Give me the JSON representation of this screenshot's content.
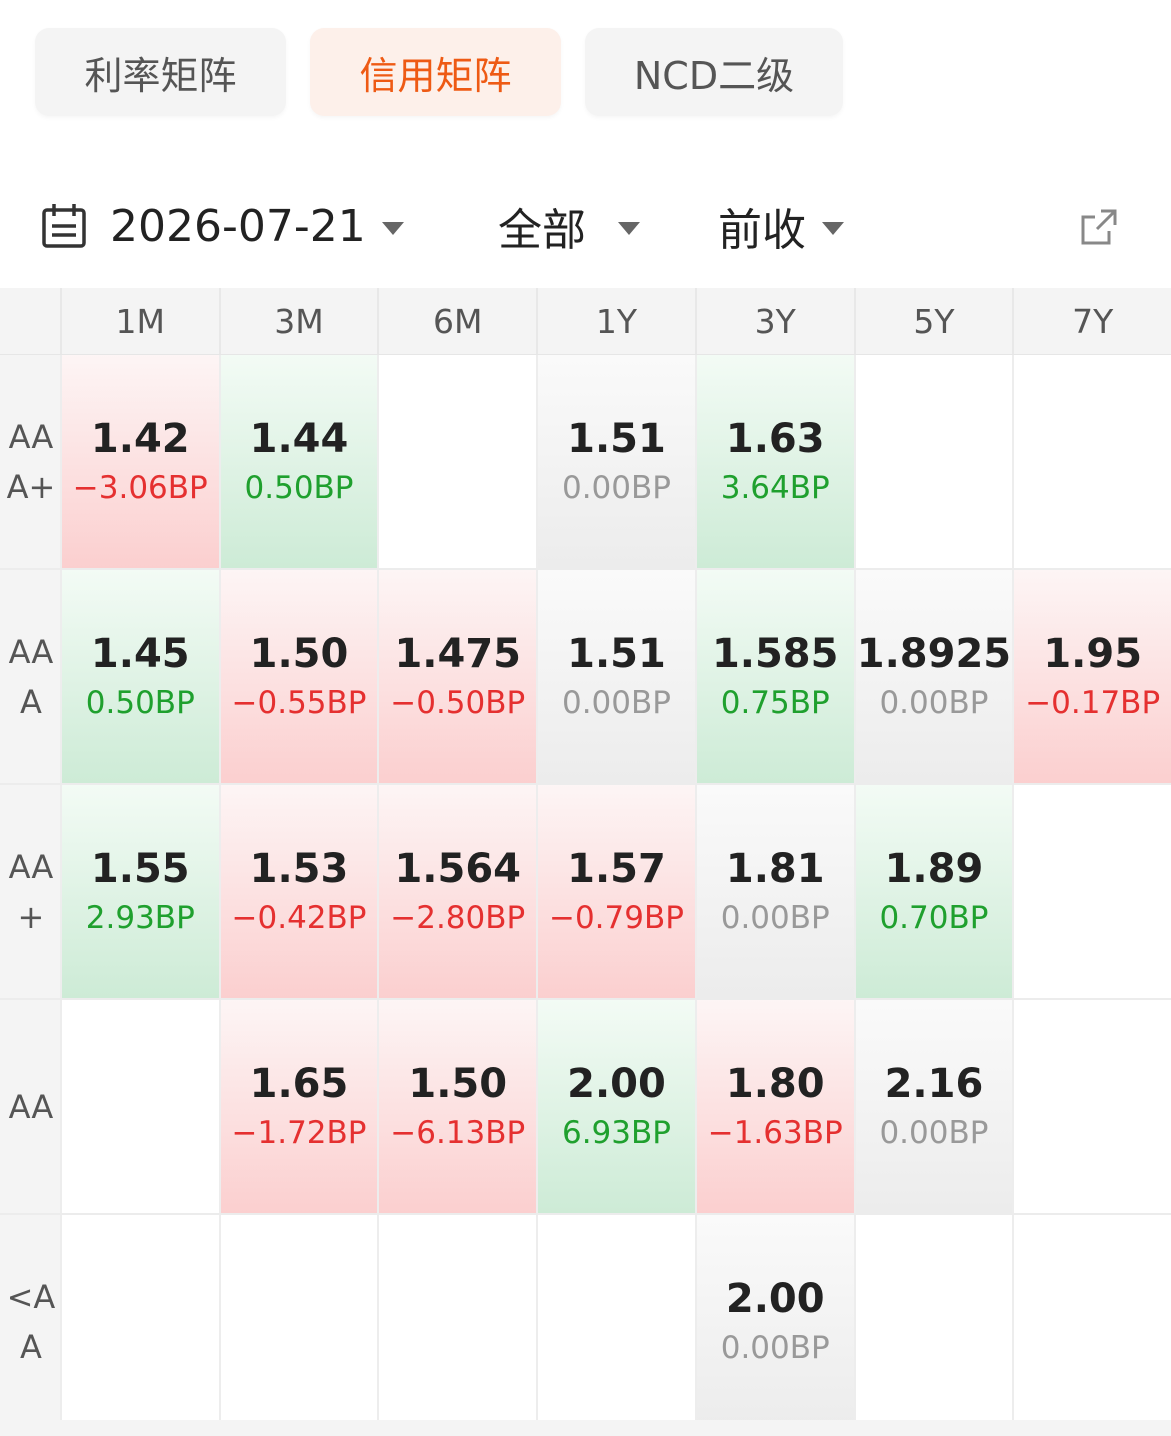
{
  "tabs": [
    {
      "label": "利率矩阵",
      "active": false
    },
    {
      "label": "信用矩阵",
      "active": true
    },
    {
      "label": "NCD二级",
      "active": false
    }
  ],
  "filters": {
    "date": "2026-07-21",
    "scope": "全部",
    "basis": "前收"
  },
  "icons": {
    "calendar": "calendar-icon",
    "export": "external-link-icon",
    "dropdown": "caret-down-icon"
  },
  "colors": {
    "accent": "#ee5a14",
    "up": "#e53030",
    "down": "#1fa02e",
    "flat": "#999999"
  },
  "matrix": {
    "columns": [
      "1M",
      "3M",
      "6M",
      "1Y",
      "3Y",
      "5Y",
      "7Y"
    ],
    "rows": [
      {
        "label": "AAA+",
        "cells": [
          {
            "value": "1.42",
            "change": "−3.06BP",
            "trend": "up"
          },
          {
            "value": "1.44",
            "change": "0.50BP",
            "trend": "down"
          },
          null,
          {
            "value": "1.51",
            "change": "0.00BP",
            "trend": "flat"
          },
          {
            "value": "1.63",
            "change": "3.64BP",
            "trend": "down"
          },
          null,
          null
        ]
      },
      {
        "label": "AAA",
        "cells": [
          {
            "value": "1.45",
            "change": "0.50BP",
            "trend": "down"
          },
          {
            "value": "1.50",
            "change": "−0.55BP",
            "trend": "up"
          },
          {
            "value": "1.475",
            "change": "−0.50BP",
            "trend": "up"
          },
          {
            "value": "1.51",
            "change": "0.00BP",
            "trend": "flat"
          },
          {
            "value": "1.585",
            "change": "0.75BP",
            "trend": "down"
          },
          {
            "value": "1.8925",
            "change": "0.00BP",
            "trend": "flat"
          },
          {
            "value": "1.95",
            "change": "−0.17BP",
            "trend": "up"
          }
        ]
      },
      {
        "label": "AA+",
        "cells": [
          {
            "value": "1.55",
            "change": "2.93BP",
            "trend": "down"
          },
          {
            "value": "1.53",
            "change": "−0.42BP",
            "trend": "up"
          },
          {
            "value": "1.564",
            "change": "−2.80BP",
            "trend": "up"
          },
          {
            "value": "1.57",
            "change": "−0.79BP",
            "trend": "up"
          },
          {
            "value": "1.81",
            "change": "0.00BP",
            "trend": "flat"
          },
          {
            "value": "1.89",
            "change": "0.70BP",
            "trend": "down"
          },
          null
        ]
      },
      {
        "label": "AA",
        "cells": [
          null,
          {
            "value": "1.65",
            "change": "−1.72BP",
            "trend": "up"
          },
          {
            "value": "1.50",
            "change": "−6.13BP",
            "trend": "up"
          },
          {
            "value": "2.00",
            "change": "6.93BP",
            "trend": "down"
          },
          {
            "value": "1.80",
            "change": "−1.63BP",
            "trend": "up"
          },
          {
            "value": "2.16",
            "change": "0.00BP",
            "trend": "flat"
          },
          null
        ]
      },
      {
        "label": "<AA",
        "cells": [
          null,
          null,
          null,
          null,
          {
            "value": "2.00",
            "change": "0.00BP",
            "trend": "flat"
          },
          null,
          null
        ]
      }
    ]
  }
}
